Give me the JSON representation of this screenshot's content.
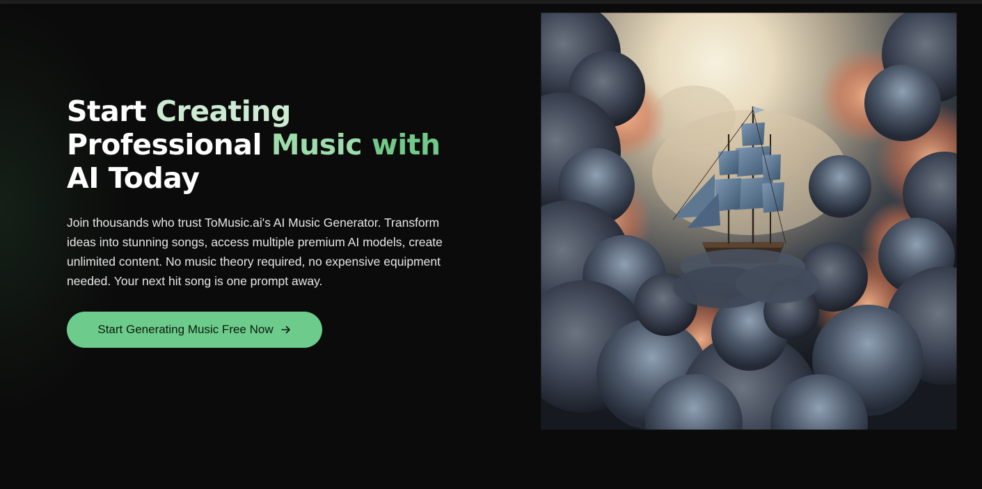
{
  "hero": {
    "headline": {
      "part1": "Start ",
      "part2": "Creating",
      "part3": "Professional ",
      "part4": "Music ",
      "part5": "with",
      "part6": "AI Today"
    },
    "description": "Join thousands who trust ToMusic.ai's AI Music Generator. Transform ideas into stunning songs, access multiple premium AI models, create unlimited content. No music theory required, no expensive equipment needed. Your next hit song is one prompt away.",
    "cta_label": "Start Generating Music Free Now",
    "cta_icon": "arrow-right-icon"
  },
  "colors": {
    "background": "#0b0b0b",
    "accent": "#6dcc8b",
    "headline_white": "#ffffff",
    "headline_green_light": "#cdebd2",
    "headline_green_mid": "#9edcab",
    "headline_green": "#72c98a"
  },
  "artwork": {
    "subject": "sailing-ship-in-clouds-image"
  }
}
